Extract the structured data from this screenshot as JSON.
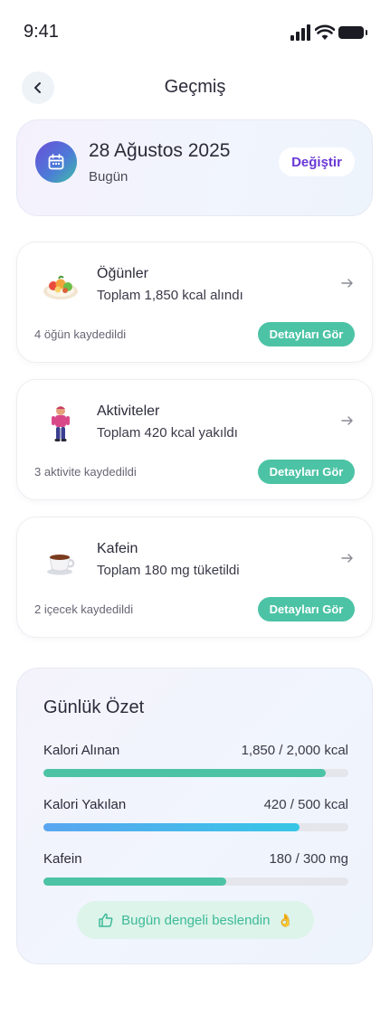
{
  "status_bar": {
    "time": "9:41"
  },
  "header": {
    "title": "Geçmiş",
    "back_icon": "chevron-left-icon"
  },
  "date_card": {
    "date": "28 Ağustos 2025",
    "relative": "Bugün",
    "change_label": "Değiştir",
    "icon": "calendar-icon"
  },
  "categories": [
    {
      "title": "Öğünler",
      "summary": "Toplam 1,850 kcal alındı",
      "count": "4 öğün kaydedildi",
      "button": "Detayları Gör",
      "icon": "meal-plate-icon"
    },
    {
      "title": "Aktiviteler",
      "summary": "Toplam 420 kcal yakıldı",
      "count": "3 aktivite kaydedildi",
      "button": "Detayları Gör",
      "icon": "person-activity-icon"
    },
    {
      "title": "Kafein",
      "summary": "Toplam 180 mg tüketildi",
      "count": "2 içecek kaydedildi",
      "button": "Detayları Gör",
      "icon": "coffee-cup-icon"
    }
  ],
  "summary": {
    "title": "Günlük Özet",
    "metrics": [
      {
        "label": "Kalori Alınan",
        "value": "1,850 / 2,000 kcal",
        "progress": 0.925,
        "color": "#4cc3a5"
      },
      {
        "label": "Kalori Yakılan",
        "value": "420 / 500 kcal",
        "progress": 0.84,
        "color": "#37c6e6"
      },
      {
        "label": "Kafein",
        "value": "180 / 300 mg",
        "progress": 0.6,
        "color": "#4cc3a5"
      }
    ],
    "tip": "Bugün dengeli beslendin",
    "tip_emoji": "👌",
    "tip_icon": "thumbs-up-icon"
  }
}
